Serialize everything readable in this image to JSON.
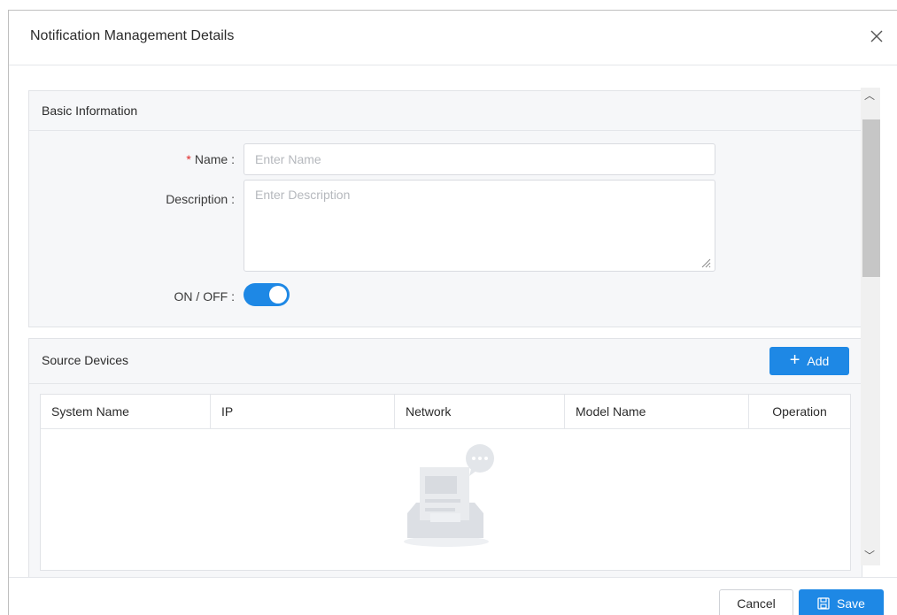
{
  "dialog": {
    "title": "Notification Management Details",
    "close_icon": "close-icon"
  },
  "basic": {
    "title": "Basic Information",
    "name_required": "*",
    "name_label": "Name :",
    "name_placeholder": "Enter Name",
    "description_label": "Description :",
    "description_placeholder": "Enter Description",
    "toggle_label": "ON / OFF :",
    "toggle_on": true
  },
  "source": {
    "title": "Source Devices",
    "add_label": "Add",
    "add_icon": "plus-icon",
    "columns": [
      "System Name",
      "IP",
      "Network",
      "Model Name",
      "Operation"
    ],
    "empty_icon": "empty-inbox-icon"
  },
  "footer": {
    "cancel_label": "Cancel",
    "save_label": "Save",
    "save_icon": "save-icon"
  },
  "colors": {
    "accent": "#1e88e5",
    "required": "#e02b2b"
  }
}
